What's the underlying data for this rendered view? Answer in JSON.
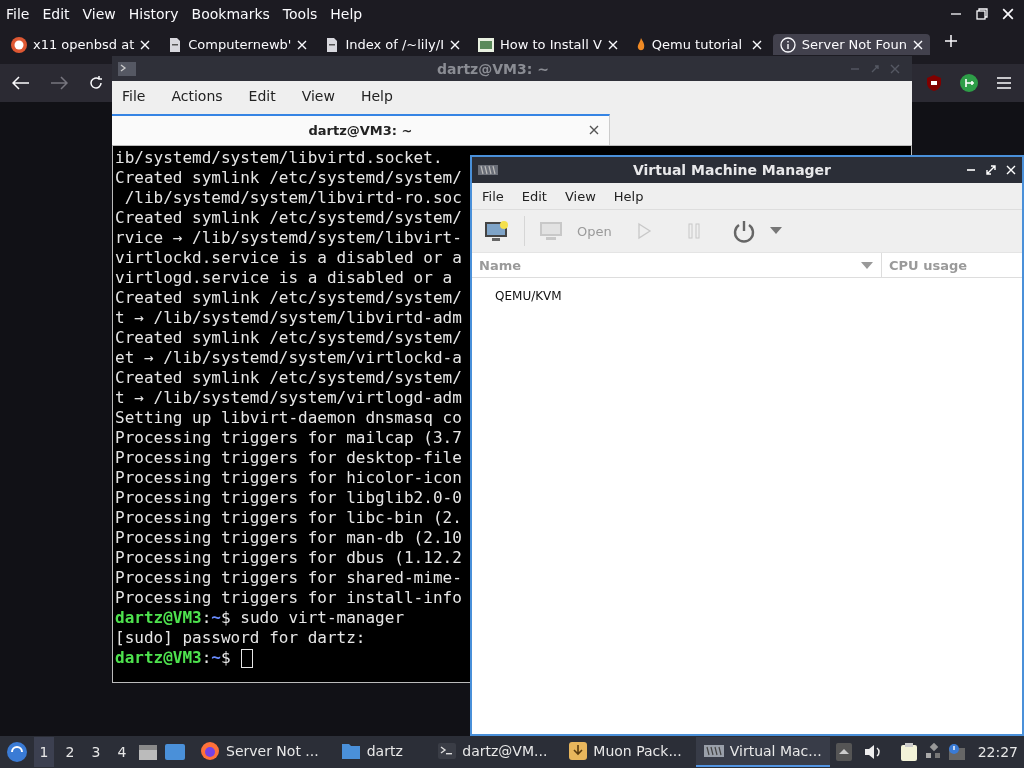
{
  "browser": {
    "menu": [
      "File",
      "Edit",
      "View",
      "History",
      "Bookmarks",
      "Tools",
      "Help"
    ],
    "tabs": [
      {
        "title": "x11 openbsd at",
        "kind": "duck",
        "selected": false
      },
      {
        "title": "Computernewb'",
        "kind": "page",
        "selected": false
      },
      {
        "title": "Index of /~lily/I",
        "kind": "page",
        "selected": false
      },
      {
        "title": "How to Install V",
        "kind": "image",
        "selected": false
      },
      {
        "title": "Qemu tutorial",
        "kind": "flame",
        "selected": false
      },
      {
        "title": "Server Not Foun",
        "kind": "info",
        "selected": true
      }
    ]
  },
  "terminal": {
    "title": "dartz@VM3: ~",
    "menu": [
      "File",
      "Actions",
      "Edit",
      "View",
      "Help"
    ],
    "tab": "dartz@VM3: ~",
    "lines": [
      {
        "kind": "output",
        "text": "ib/systemd/system/libvirtd.socket."
      },
      {
        "kind": "output",
        "text": "Created symlink /etc/systemd/system/"
      },
      {
        "kind": "output",
        "text": " /lib/systemd/system/libvirtd-ro.soc"
      },
      {
        "kind": "output",
        "text": "Created symlink /etc/systemd/system/"
      },
      {
        "kind": "output",
        "text": "rvice → /lib/systemd/system/libvirt-"
      },
      {
        "kind": "output",
        "text": "virtlockd.service is a disabled or a"
      },
      {
        "kind": "output",
        "text": "virtlogd.service is a disabled or a"
      },
      {
        "kind": "output",
        "text": "Created symlink /etc/systemd/system/"
      },
      {
        "kind": "output",
        "text": "t → /lib/systemd/system/libvirtd-adm"
      },
      {
        "kind": "output",
        "text": "Created symlink /etc/systemd/system/"
      },
      {
        "kind": "output",
        "text": "et → /lib/systemd/system/virtlockd-a"
      },
      {
        "kind": "output",
        "text": "Created symlink /etc/systemd/system/"
      },
      {
        "kind": "output",
        "text": "t → /lib/systemd/system/virtlogd-adm"
      },
      {
        "kind": "output",
        "text": "Setting up libvirt-daemon dnsmasq co"
      },
      {
        "kind": "output",
        "text": "Processing triggers for mailcap (3.7"
      },
      {
        "kind": "output",
        "text": "Processing triggers for desktop-file"
      },
      {
        "kind": "output",
        "text": "Processing triggers for hicolor-icon"
      },
      {
        "kind": "output",
        "text": "Processing triggers for libglib2.0-0"
      },
      {
        "kind": "output",
        "text": "Processing triggers for libc-bin (2."
      },
      {
        "kind": "output",
        "text": "Processing triggers for man-db (2.10"
      },
      {
        "kind": "output",
        "text": "Processing triggers for dbus (1.12.2"
      },
      {
        "kind": "output",
        "text": "Processing triggers for shared-mime-"
      },
      {
        "kind": "output",
        "text": "Processing triggers for install-info"
      },
      {
        "kind": "prompt",
        "user": "dartz@VM3",
        "sep": ":",
        "path": "~",
        "command": "$ sudo virt-manager",
        "cursor": false
      },
      {
        "kind": "output",
        "text": "[sudo] password for dartz:"
      },
      {
        "kind": "prompt",
        "user": "dartz@VM3",
        "sep": ":",
        "path": "~",
        "command": "$",
        "cursor": true
      }
    ]
  },
  "vmm": {
    "title": "Virtual Machine Manager",
    "menu": [
      "File",
      "Edit",
      "View",
      "Help"
    ],
    "open_label": "Open",
    "columns": [
      "Name",
      "CPU usage"
    ],
    "rows": [
      {
        "name": "QEMU/KVM"
      }
    ]
  },
  "taskbar": {
    "workspaces": [
      {
        "label": "1",
        "selected": true
      },
      {
        "label": "2",
        "selected": false
      },
      {
        "label": "3",
        "selected": false
      },
      {
        "label": "4",
        "selected": false
      }
    ],
    "tasks": [
      {
        "label": "Server Not ...",
        "kind": "browser",
        "selected": false
      },
      {
        "label": "dartz",
        "kind": "folder",
        "selected": false
      },
      {
        "label": "dartz@VM...",
        "kind": "terminal",
        "selected": false
      },
      {
        "label": "Muon Pack...",
        "kind": "package",
        "selected": false
      },
      {
        "label": "Virtual Mac...",
        "kind": "vmm",
        "selected": true
      }
    ],
    "clock": "22:27"
  }
}
